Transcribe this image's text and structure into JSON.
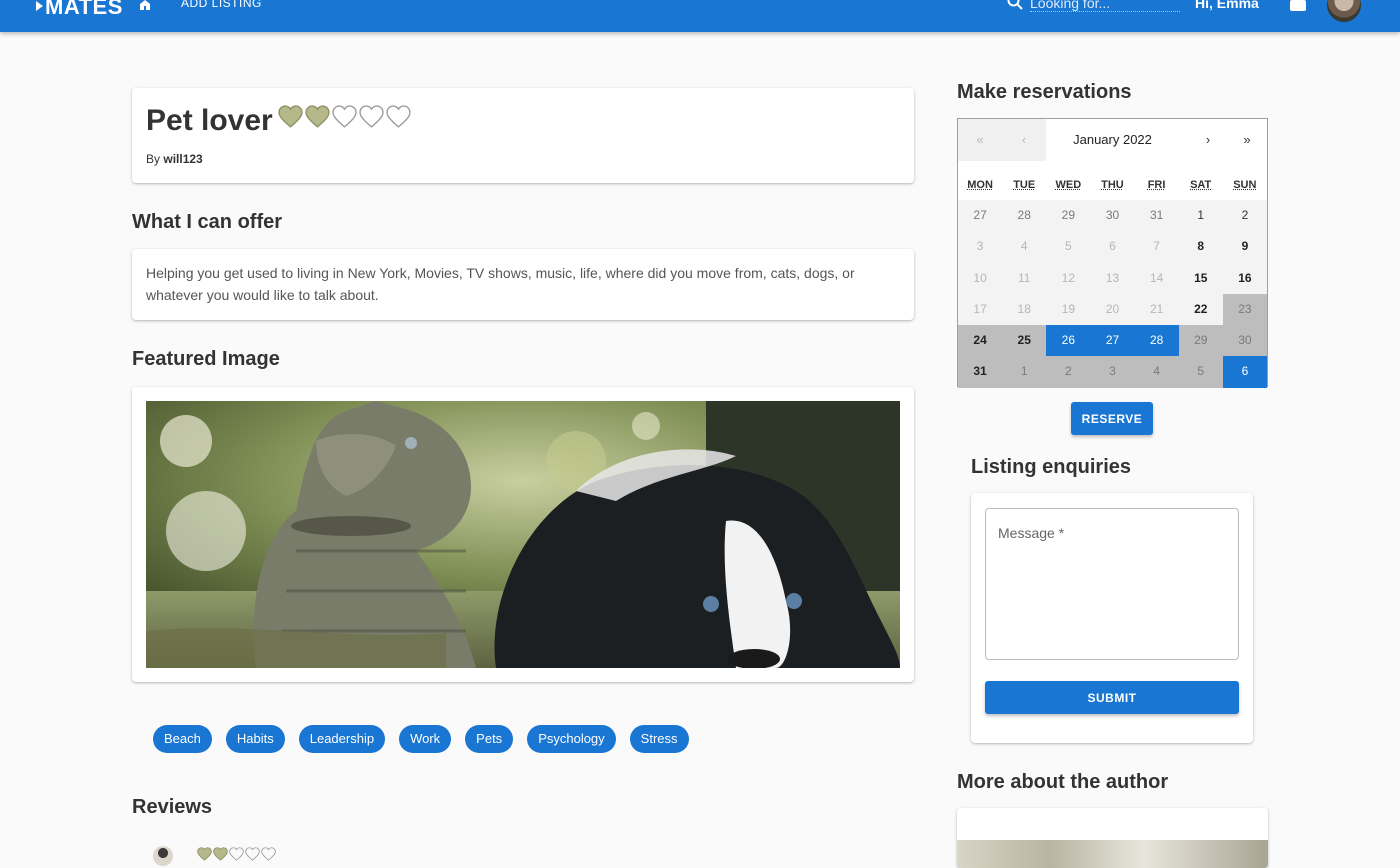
{
  "nav": {
    "logo": "MATES",
    "add_listing": "ADD LISTING",
    "search_placeholder": "Looking for...",
    "greeting": "Hi, Emma"
  },
  "listing": {
    "title": "Pet lover",
    "rating": 2,
    "rating_max": 5,
    "by_prefix": "By",
    "author": "will123"
  },
  "offer": {
    "heading": "What I can offer",
    "text": "Helping you get used to living in New York, Movies, TV shows, music, life, where did you move from, cats, dogs, or whatever you would like to talk about."
  },
  "featured": {
    "heading": "Featured Image"
  },
  "tags": [
    "Beach",
    "Habits",
    "Leadership",
    "Work",
    "Pets",
    "Psychology",
    "Stress"
  ],
  "reviews": {
    "heading": "Reviews",
    "first_rating": 2
  },
  "reservations": {
    "heading": "Make reservations",
    "calendar": {
      "prev2": "«",
      "prev": "‹",
      "label": "January 2022",
      "next": "›",
      "next2": "»",
      "weekdays": [
        "MON",
        "TUE",
        "WED",
        "THU",
        "FRI",
        "SAT",
        "SUN"
      ],
      "days": [
        {
          "d": "27",
          "s": "muted"
        },
        {
          "d": "28",
          "s": "muted"
        },
        {
          "d": "29",
          "s": "muted"
        },
        {
          "d": "30",
          "s": "muted"
        },
        {
          "d": "31",
          "s": "muted"
        },
        {
          "d": "1",
          "s": "normal"
        },
        {
          "d": "2",
          "s": "normal"
        },
        {
          "d": "3",
          "s": "disabled"
        },
        {
          "d": "4",
          "s": "disabled"
        },
        {
          "d": "5",
          "s": "disabled"
        },
        {
          "d": "6",
          "s": "disabled"
        },
        {
          "d": "7",
          "s": "disabled"
        },
        {
          "d": "8",
          "s": "bold"
        },
        {
          "d": "9",
          "s": "bold"
        },
        {
          "d": "10",
          "s": "disabled"
        },
        {
          "d": "11",
          "s": "disabled"
        },
        {
          "d": "12",
          "s": "disabled"
        },
        {
          "d": "13",
          "s": "disabled"
        },
        {
          "d": "14",
          "s": "disabled"
        },
        {
          "d": "15",
          "s": "bold"
        },
        {
          "d": "16",
          "s": "bold"
        },
        {
          "d": "17",
          "s": "disabled"
        },
        {
          "d": "18",
          "s": "disabled"
        },
        {
          "d": "19",
          "s": "disabled"
        },
        {
          "d": "20",
          "s": "disabled"
        },
        {
          "d": "21",
          "s": "disabled"
        },
        {
          "d": "22",
          "s": "bold"
        },
        {
          "d": "23",
          "s": "booked"
        },
        {
          "d": "24",
          "s": "booked-bold"
        },
        {
          "d": "25",
          "s": "booked-bold"
        },
        {
          "d": "26",
          "s": "selected"
        },
        {
          "d": "27",
          "s": "selected"
        },
        {
          "d": "28",
          "s": "selected"
        },
        {
          "d": "29",
          "s": "booked"
        },
        {
          "d": "30",
          "s": "booked"
        },
        {
          "d": "31",
          "s": "booked-bold"
        },
        {
          "d": "1",
          "s": "booked-muted"
        },
        {
          "d": "2",
          "s": "booked-muted"
        },
        {
          "d": "3",
          "s": "booked-muted"
        },
        {
          "d": "4",
          "s": "booked-muted"
        },
        {
          "d": "5",
          "s": "booked-muted"
        },
        {
          "d": "6",
          "s": "selected"
        }
      ]
    },
    "reserve_label": "RESERVE"
  },
  "enquiries": {
    "heading": "Listing enquiries",
    "message_label": "Message *",
    "submit_label": "SUBMIT"
  },
  "author_section": {
    "heading": "More about the author"
  },
  "colors": {
    "primary": "#1976d2",
    "heart_filled": "#b5b98a",
    "heart_empty_stroke": "#9a9a9a"
  }
}
